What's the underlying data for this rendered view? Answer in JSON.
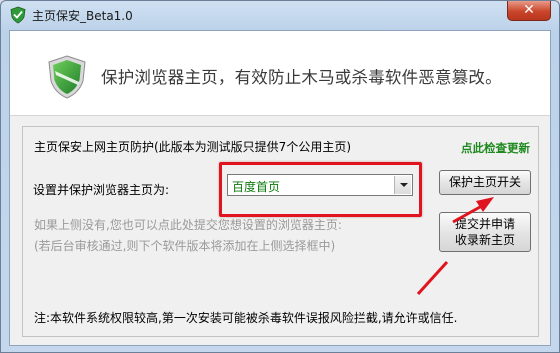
{
  "window": {
    "title": "主页保安_Beta1.0",
    "close_glyph": "✕"
  },
  "header": {
    "tagline": "保护浏览器主页，有效防止木马或杀毒软件恶意篡改。",
    "icon": "shield-check-icon"
  },
  "group": {
    "info": "主页保安上网主页防护(此版本为测试版只提供7个公用主页)",
    "update_link": "点此检查更新",
    "set_label": "设置并保护浏览器主页为:",
    "combo_value": "百度首页",
    "toggle_button": "保护主页开关",
    "submit_button_line1": "提交并申请",
    "submit_button_line2": "收录新主页",
    "gray_line1": "如果上侧没有,您也可以点此处提交您想设置的浏览器主页:",
    "gray_line2": "(若后台审核通过,则下个软件版本将添加在上侧选择框中)",
    "note": "注:本软件系统权限较高,第一次安装可能被杀毒软件误报风险拦截,请允许或信任."
  },
  "colors": {
    "highlight": "#e0141e",
    "update_link": "#1f8a1f",
    "combo_text": "#0a7a0a"
  }
}
